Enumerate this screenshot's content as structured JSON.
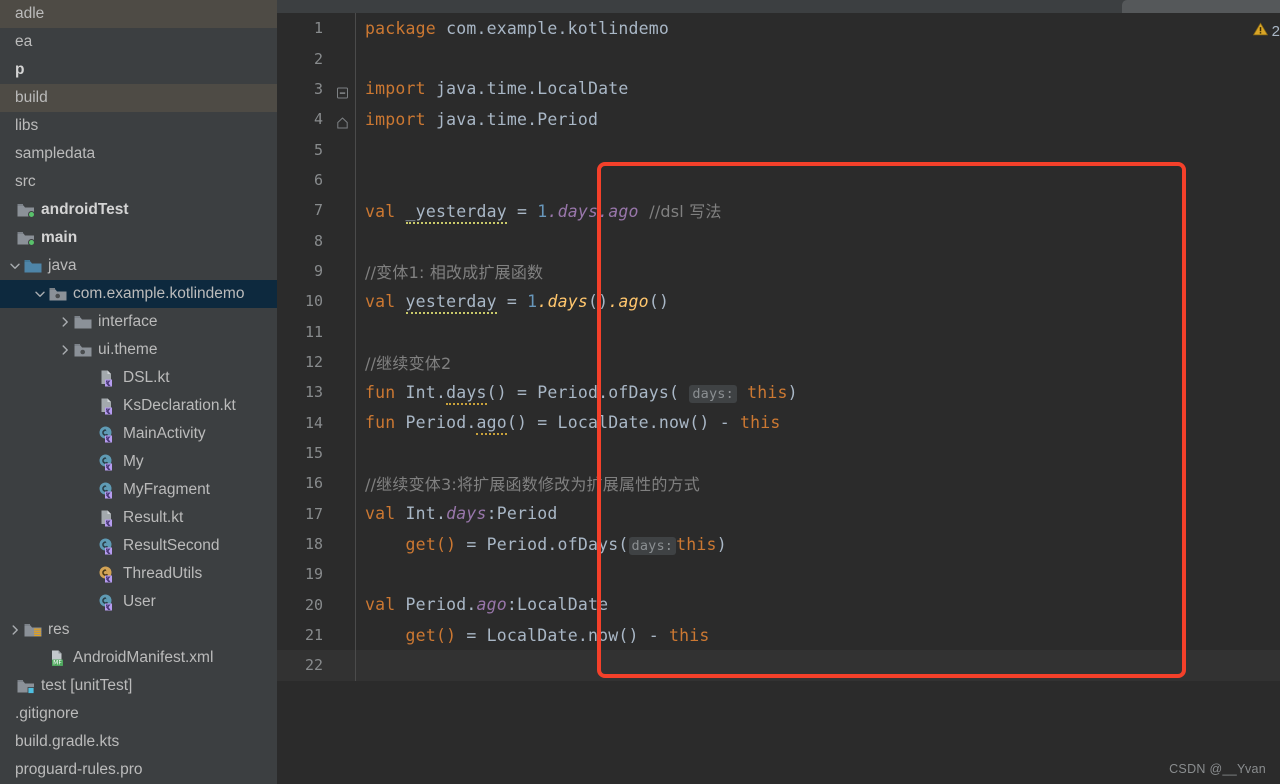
{
  "window": {
    "watermark": "CSDN @__Yvan",
    "warning_count": "2",
    "warning_icon": "warning-triangle-icon"
  },
  "sidebar": {
    "background": "#3c3f41",
    "selected_color": "#0d293e",
    "highlight_color": "#4e4b45",
    "items": [
      {
        "label": "adle",
        "indent": 0,
        "icon": "none",
        "arrow": "none",
        "state": "highlight",
        "bold": false
      },
      {
        "label": "ea",
        "indent": 0,
        "icon": "none",
        "arrow": "none",
        "state": "normal",
        "bold": false
      },
      {
        "label": "p",
        "indent": 0,
        "icon": "none",
        "arrow": "none",
        "state": "normal",
        "bold": true
      },
      {
        "label": "build",
        "indent": 0,
        "icon": "none",
        "arrow": "none",
        "state": "highlight",
        "bold": false
      },
      {
        "label": "libs",
        "indent": 0,
        "icon": "none",
        "arrow": "none",
        "state": "normal",
        "bold": false
      },
      {
        "label": "sampledata",
        "indent": 0,
        "icon": "none",
        "arrow": "none",
        "state": "normal",
        "bold": false
      },
      {
        "label": "src",
        "indent": 0,
        "icon": "none",
        "arrow": "none",
        "state": "normal",
        "bold": false
      },
      {
        "label": "androidTest",
        "indent": 0,
        "icon": "source-folder-green-icon",
        "arrow": "none",
        "state": "normal",
        "bold": true
      },
      {
        "label": "main",
        "indent": 0,
        "icon": "source-folder-green-icon",
        "arrow": "none",
        "state": "normal",
        "bold": true
      },
      {
        "label": "java",
        "indent": 1,
        "icon": "folder-blue-icon",
        "arrow": "down",
        "state": "normal",
        "bold": false
      },
      {
        "label": "com.example.kotlindemo",
        "indent": 2,
        "icon": "package-icon",
        "arrow": "down",
        "state": "selected",
        "bold": false
      },
      {
        "label": "interface",
        "indent": 3,
        "icon": "folder-gray-icon",
        "arrow": "right",
        "state": "normal",
        "bold": false
      },
      {
        "label": "ui.theme",
        "indent": 3,
        "icon": "package-icon",
        "arrow": "right",
        "state": "normal",
        "bold": false
      },
      {
        "label": "DSL.kt",
        "indent": 4,
        "icon": "kotlin-file-icon",
        "arrow": "none",
        "state": "normal",
        "bold": false
      },
      {
        "label": "KsDeclaration.kt",
        "indent": 4,
        "icon": "kotlin-file-icon",
        "arrow": "none",
        "state": "normal",
        "bold": false
      },
      {
        "label": "MainActivity",
        "indent": 4,
        "icon": "kotlin-class-icon",
        "arrow": "none",
        "state": "normal",
        "bold": false
      },
      {
        "label": "My",
        "indent": 4,
        "icon": "kotlin-class-icon",
        "arrow": "none",
        "state": "normal",
        "bold": false
      },
      {
        "label": "MyFragment",
        "indent": 4,
        "icon": "kotlin-class-icon",
        "arrow": "none",
        "state": "normal",
        "bold": false
      },
      {
        "label": "Result.kt",
        "indent": 4,
        "icon": "kotlin-file-icon",
        "arrow": "none",
        "state": "normal",
        "bold": false
      },
      {
        "label": "ResultSecond",
        "indent": 4,
        "icon": "kotlin-class-icon",
        "arrow": "none",
        "state": "normal",
        "bold": false
      },
      {
        "label": "ThreadUtils",
        "indent": 4,
        "icon": "kotlin-object-icon",
        "arrow": "none",
        "state": "normal",
        "bold": false
      },
      {
        "label": "User",
        "indent": 4,
        "icon": "kotlin-class-icon",
        "arrow": "none",
        "state": "normal",
        "bold": false
      },
      {
        "label": "res",
        "indent": 1,
        "icon": "res-folder-icon",
        "arrow": "right",
        "state": "normal",
        "bold": false
      },
      {
        "label": "AndroidManifest.xml",
        "indent": 2,
        "icon": "manifest-icon",
        "arrow": "none",
        "state": "normal",
        "bold": false
      },
      {
        "label": "test [unitTest]",
        "indent": 0,
        "icon": "test-folder-icon",
        "arrow": "none",
        "state": "normal",
        "bold": false
      },
      {
        "label": ".gitignore",
        "indent": 0,
        "icon": "none",
        "arrow": "none",
        "state": "normal",
        "bold": false
      },
      {
        "label": "build.gradle.kts",
        "indent": 0,
        "icon": "none",
        "arrow": "none",
        "state": "normal",
        "bold": false
      },
      {
        "label": "proguard-rules.pro",
        "indent": 0,
        "icon": "none",
        "arrow": "none",
        "state": "normal",
        "bold": false
      }
    ]
  },
  "editor": {
    "background": "#2b2b2b",
    "annotation_box_color": "#f4402a",
    "lines": [
      {
        "num": "1",
        "fold": "none"
      },
      {
        "num": "2",
        "fold": "none"
      },
      {
        "num": "3",
        "fold": "minus"
      },
      {
        "num": "4",
        "fold": "end"
      },
      {
        "num": "5",
        "fold": "none"
      },
      {
        "num": "6",
        "fold": "none"
      },
      {
        "num": "7",
        "fold": "none"
      },
      {
        "num": "8",
        "fold": "none"
      },
      {
        "num": "9",
        "fold": "none"
      },
      {
        "num": "10",
        "fold": "none"
      },
      {
        "num": "11",
        "fold": "none"
      },
      {
        "num": "12",
        "fold": "none"
      },
      {
        "num": "13",
        "fold": "none"
      },
      {
        "num": "14",
        "fold": "none"
      },
      {
        "num": "15",
        "fold": "none"
      },
      {
        "num": "16",
        "fold": "none"
      },
      {
        "num": "17",
        "fold": "none"
      },
      {
        "num": "18",
        "fold": "none"
      },
      {
        "num": "19",
        "fold": "none"
      },
      {
        "num": "20",
        "fold": "none"
      },
      {
        "num": "21",
        "fold": "none"
      },
      {
        "num": "22",
        "fold": "none"
      }
    ],
    "code": {
      "l1_kw": "package",
      "l1_pkg": " com.example.kotlindemo",
      "l3_kw": "import",
      "l3_rest": " java.time.LocalDate",
      "l4_kw": "import",
      "l4_rest": " java.time.Period",
      "l7_kw": "val",
      "l7_name": "_yesterday",
      "l7_eq": " = ",
      "l7_num": "1",
      "l7_prop": ".days.ago",
      "l7_cmt": "  //dsl 写法",
      "l9_cmt": "//变体1: 相改成扩展函数",
      "l10_kw": "val",
      "l10_name": "yesterday",
      "l10_eq": " = ",
      "l10_num": "1",
      "l10_fn1": ".days",
      "l10_p1": "()",
      "l10_fn2": ".ago",
      "l10_p2": "()",
      "l12_cmt": "//继续变体2",
      "l13_kw": "fun",
      "l13_recv": " Int.",
      "l13_fn": "days",
      "l13_mid": "() = Period.ofDays(",
      "l13_hint": "days:",
      "l13_this": "this",
      "l13_end": ")",
      "l14_kw": "fun",
      "l14_recv": " Period.",
      "l14_fn": "ago",
      "l14_mid": "() = LocalDate.now() - ",
      "l14_this": "this",
      "l16_cmt": "//继续变体3:将扩展函数修改为扩展属性的方式",
      "l17_kw": "val",
      "l17_recv": " Int.",
      "l17_prop": "days",
      "l17_type": ":Period",
      "l18_get": "get()",
      "l18_mid": " = Period.ofDays(",
      "l18_hint": "days:",
      "l18_this": "this",
      "l18_end": ")",
      "l20_kw": "val",
      "l20_recv": " Period.",
      "l20_prop": "ago",
      "l20_type": ":LocalDate",
      "l21_get": "get()",
      "l21_mid": " = LocalDate.now() - ",
      "l21_this": "this"
    }
  }
}
